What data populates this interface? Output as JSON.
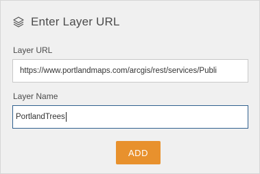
{
  "header": {
    "icon": "layers-icon",
    "title": "Enter Layer URL"
  },
  "layer_url": {
    "label": "Layer URL",
    "value": "https://www.portlandmaps.com/arcgis/rest/services/Publi"
  },
  "layer_name": {
    "label": "Layer Name",
    "value": "PortlandTrees"
  },
  "add_button": {
    "label": "ADD",
    "color": "#e8912d"
  }
}
